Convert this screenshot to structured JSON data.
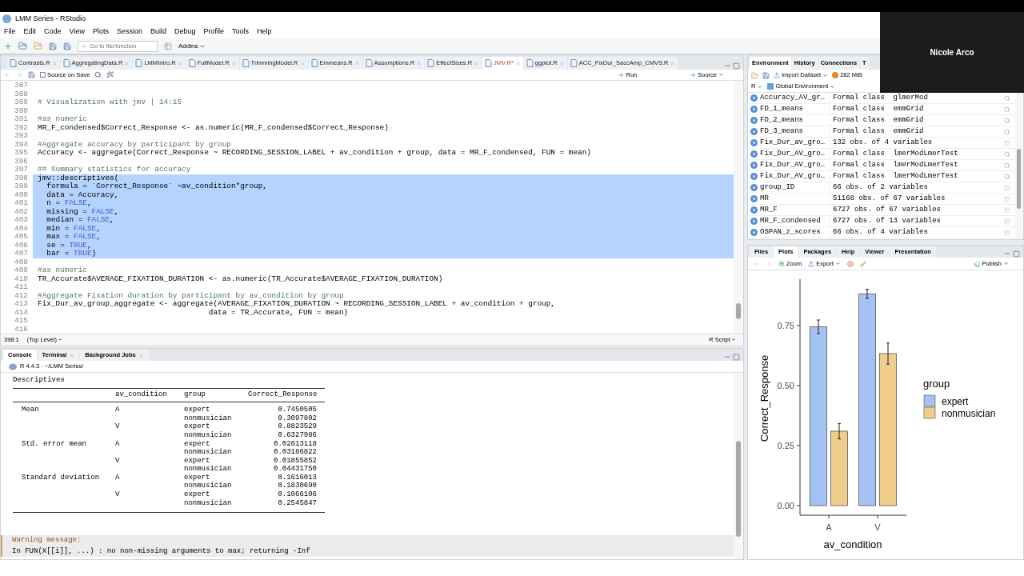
{
  "window": {
    "title": "LMM Series - RStudio"
  },
  "menu": [
    "File",
    "Edit",
    "Code",
    "View",
    "Plots",
    "Session",
    "Build",
    "Debug",
    "Profile",
    "Tools",
    "Help"
  ],
  "toolbar": {
    "goto_placeholder": "Go to file/function",
    "addins": "Addins"
  },
  "editor": {
    "tabs": [
      {
        "label": "Contrasts.R",
        "selected": false
      },
      {
        "label": "AggregatingData.R",
        "selected": false
      },
      {
        "label": "LMMIntro.R",
        "selected": false
      },
      {
        "label": "FullModel.R",
        "selected": false
      },
      {
        "label": "TrimmingModel.R",
        "selected": false
      },
      {
        "label": "Emmeans.R",
        "selected": false
      },
      {
        "label": "Assumptions.R",
        "selected": false
      },
      {
        "label": "EffectSizes.R",
        "selected": false
      },
      {
        "label": "JMV.R*",
        "selected": true
      },
      {
        "label": "ggplot.R",
        "selected": false
      },
      {
        "label": "ACC_FixDur_SaccAmp_CMVS.R",
        "selected": false
      }
    ],
    "source_on_save": {
      "label": "Source on Save",
      "checked": false
    },
    "run": "Run",
    "source": "Source",
    "lines": [
      {
        "number": "387",
        "kind": "blank",
        "selected": false
      },
      {
        "number": "388",
        "kind": "blank",
        "selected": false
      },
      {
        "number": "389",
        "kind": "comment",
        "text": "# Visualization with jmv | 14:15",
        "selected": false
      },
      {
        "number": "390",
        "kind": "blank",
        "selected": false
      },
      {
        "number": "391",
        "kind": "comment",
        "text": "#as numeric",
        "selected": false
      },
      {
        "number": "392",
        "kind": "code",
        "text": "MR_F_condensed$Correct_Response <- as.numeric(MR_F_condensed$Correct_Response)",
        "selected": false
      },
      {
        "number": "393",
        "kind": "blank",
        "selected": false
      },
      {
        "number": "394",
        "kind": "comment",
        "text": "#Aggregate accuracy by participant by group",
        "selected": false
      },
      {
        "number": "395",
        "kind": "code",
        "text": "Accuracy <- aggregate(Correct_Response ~ RECORDING_SESSION_LABEL + av_condition + group, data = MR_F_condensed, FUN = mean)",
        "selected": false
      },
      {
        "number": "396",
        "kind": "blank",
        "selected": false
      },
      {
        "number": "397",
        "kind": "comment",
        "text": "## Summary statistics for accuracy",
        "selected": false
      },
      {
        "number": "398",
        "kind": "code",
        "text": "jmv::descriptives(",
        "selected": true
      },
      {
        "number": "399",
        "kind": "code",
        "text": "  formula = `Correct_Response` ~av_condition*group,",
        "selected": true
      },
      {
        "number": "400",
        "kind": "code",
        "text": "  data = Accuracy,",
        "selected": true
      },
      {
        "number": "401",
        "kind": "mixed",
        "parts": [
          {
            "text": "  n = ",
            "kind": "code"
          },
          {
            "text": "FALSE",
            "kind": "constant"
          },
          {
            "text": ",",
            "kind": "code"
          }
        ],
        "selected": true
      },
      {
        "number": "402",
        "kind": "mixed",
        "parts": [
          {
            "text": "  missing = ",
            "kind": "code"
          },
          {
            "text": "FALSE",
            "kind": "constant"
          },
          {
            "text": ",",
            "kind": "code"
          }
        ],
        "selected": true
      },
      {
        "number": "403",
        "kind": "mixed",
        "parts": [
          {
            "text": "  median = ",
            "kind": "code"
          },
          {
            "text": "FALSE",
            "kind": "constant"
          },
          {
            "text": ",",
            "kind": "code"
          }
        ],
        "selected": true
      },
      {
        "number": "404",
        "kind": "mixed",
        "parts": [
          {
            "text": "  min = ",
            "kind": "code"
          },
          {
            "text": "FALSE",
            "kind": "constant"
          },
          {
            "text": ",",
            "kind": "code"
          }
        ],
        "selected": true
      },
      {
        "number": "405",
        "kind": "mixed",
        "parts": [
          {
            "text": "  max = ",
            "kind": "code"
          },
          {
            "text": "FALSE",
            "kind": "constant"
          },
          {
            "text": ",",
            "kind": "code"
          }
        ],
        "selected": true
      },
      {
        "number": "406",
        "kind": "mixed",
        "parts": [
          {
            "text": "  se = ",
            "kind": "code"
          },
          {
            "text": "TRUE",
            "kind": "constant"
          },
          {
            "text": ",",
            "kind": "code"
          }
        ],
        "selected": true
      },
      {
        "number": "407",
        "kind": "mixed",
        "parts": [
          {
            "text": "  bar = ",
            "kind": "code"
          },
          {
            "text": "TRUE",
            "kind": "constant"
          },
          {
            "text": ")",
            "kind": "code"
          }
        ],
        "selected": true
      },
      {
        "number": "408",
        "kind": "blank",
        "selected": false
      },
      {
        "number": "409",
        "kind": "comment",
        "text": "#as numeric",
        "selected": false
      },
      {
        "number": "410",
        "kind": "code",
        "text": "TR_Accurate$AVERAGE_FIXATION_DURATION <- as.numeric(TR_Accurate$AVERAGE_FIXATION_DURATION)",
        "selected": false
      },
      {
        "number": "411",
        "kind": "blank",
        "selected": false
      },
      {
        "number": "412",
        "kind": "comment",
        "text": "#Aggregate Fixation duration by participant by av_condition by group",
        "selected": false
      },
      {
        "number": "413",
        "kind": "code",
        "text": "Fix_Dur_av_group_aggregate <- aggregate(AVERAGE_FIXATION_DURATION ~ RECORDING_SESSION_LABEL + av_condition + group,",
        "selected": false
      },
      {
        "number": "414",
        "kind": "code",
        "text": "                                      data = TR_Accurate, FUN = mean)",
        "selected": false
      },
      {
        "number": "415",
        "kind": "blank",
        "selected": false
      },
      {
        "number": "416",
        "kind": "blank",
        "selected": false
      }
    ],
    "status": {
      "position": "398:1",
      "scope": "(Top Level) ÷",
      "file_type": "R Script ÷"
    }
  },
  "console": {
    "tabs": [
      {
        "label": "Console",
        "selected": true
      },
      {
        "label": "Terminal",
        "selected": false
      },
      {
        "label": "Background Jobs",
        "selected": false
      }
    ],
    "path": "R 4.4.3 · ~/LMM Series/",
    "title": "Descriptives",
    "columns": [
      "av_condition",
      "group",
      "Correct_Response"
    ],
    "stats": [
      {
        "label": "Mean",
        "conditions": [
          {
            "label": "A",
            "groups": [
              {
                "group": "expert",
                "value": "0.7450505"
              },
              {
                "group": "nonmusician",
                "value": "0.3097802"
              }
            ]
          },
          {
            "label": "V",
            "groups": [
              {
                "group": "expert",
                "value": "0.8823529"
              },
              {
                "group": "nonmusician",
                "value": "0.6327986"
              }
            ]
          }
        ]
      },
      {
        "label": "Std. error mean",
        "conditions": [
          {
            "label": "A",
            "groups": [
              {
                "group": "expert",
                "value": "0.02813118"
              },
              {
                "group": "nonmusician",
                "value": "0.03186822"
              }
            ]
          },
          {
            "label": "V",
            "groups": [
              {
                "group": "expert",
                "value": "0.01855852"
              },
              {
                "group": "nonmusician",
                "value": "0.04431750"
              }
            ]
          }
        ]
      },
      {
        "label": "Standard deviation",
        "conditions": [
          {
            "label": "A",
            "groups": [
              {
                "group": "expert",
                "value": "0.1616013"
              },
              {
                "group": "nonmusician",
                "value": "0.1830690"
              }
            ]
          },
          {
            "label": "V",
            "groups": [
              {
                "group": "expert",
                "value": "0.1066106"
              },
              {
                "group": "nonmusician",
                "value": "0.2545847"
              }
            ]
          }
        ]
      }
    ],
    "warning": {
      "title": "Warning message:",
      "text": "In FUN(X[[i]], ...) : no non-missing arguments to max; returning -Inf"
    }
  },
  "environment": {
    "tabs": [
      {
        "label": "Environment",
        "selected": true
      },
      {
        "label": "History",
        "selected": false
      },
      {
        "label": "Connections",
        "selected": false
      },
      {
        "label": "T",
        "selected": false
      }
    ],
    "import": "Import Dataset",
    "memory": "282 MiB",
    "language": "R",
    "scope": "Global Environment",
    "rows": [
      {
        "name": "Accuracy_AV_gr…",
        "value": "Formal class  glmerMod",
        "kind": "object"
      },
      {
        "name": "FD_1_means",
        "value": "Formal class  emmGrid",
        "kind": "object"
      },
      {
        "name": "FD_2_means",
        "value": "Formal class  emmGrid",
        "kind": "object"
      },
      {
        "name": "FD_3_means",
        "value": "Formal class  emmGrid",
        "kind": "object"
      },
      {
        "name": "Fix_Dur_av_gro…",
        "value": "132 obs. of 4 variables",
        "kind": "data"
      },
      {
        "name": "Fix_Dur_AV_gro…",
        "value": "Formal class  lmerModLmerTest",
        "kind": "object"
      },
      {
        "name": "Fix_Dur_AV_gro…",
        "value": "Formal class  lmerModLmerTest",
        "kind": "object"
      },
      {
        "name": "Fix_Dur_AV_gro…",
        "value": "Formal class  lmerModLmerTest",
        "kind": "object"
      },
      {
        "name": "group_ID",
        "value": "66 obs. of 2 variables",
        "kind": "data"
      },
      {
        "name": "MR",
        "value": "51168 obs. of 67 variables",
        "kind": "data"
      },
      {
        "name": "MR_F",
        "value": "6727 obs. of 67 variables",
        "kind": "data"
      },
      {
        "name": "MR_F_condensed",
        "value": "6727 obs. of 13 variables",
        "kind": "data"
      },
      {
        "name": "OSPAN_z_scores",
        "value": "66 obs. of 4 variables",
        "kind": "data"
      }
    ]
  },
  "plots": {
    "tabs": [
      {
        "label": "Files",
        "selected": false
      },
      {
        "label": "Plots",
        "selected": true
      },
      {
        "label": "Packages",
        "selected": false
      },
      {
        "label": "Help",
        "selected": false
      },
      {
        "label": "Viewer",
        "selected": false
      },
      {
        "label": "Presentation",
        "selected": false
      }
    ],
    "zoom": "Zoom",
    "export": "Export",
    "publish": "Publish",
    "chart_data": {
      "type": "bar",
      "xlabel": "av_condition",
      "ylabel": "Correct_Response",
      "legend": {
        "title": "group"
      },
      "categories": [
        "A",
        "V"
      ],
      "series": [
        {
          "name": "expert",
          "color": "#a4c2f4",
          "values": [
            0.745,
            0.882
          ],
          "errors": [
            0.028,
            0.019
          ]
        },
        {
          "name": "nonmusician",
          "color": "#f0cd8a",
          "values": [
            0.31,
            0.633
          ],
          "errors": [
            0.032,
            0.044
          ]
        }
      ],
      "ylim": [
        -0.04,
        0.943
      ],
      "yticks": [
        {
          "value": 0,
          "label": "0.00"
        },
        {
          "value": 0.25,
          "label": "0.25"
        },
        {
          "value": 0.5,
          "label": "0.50"
        },
        {
          "value": 0.75,
          "label": "0.75"
        }
      ]
    }
  },
  "video": {
    "participant": "Nicole Arco"
  }
}
